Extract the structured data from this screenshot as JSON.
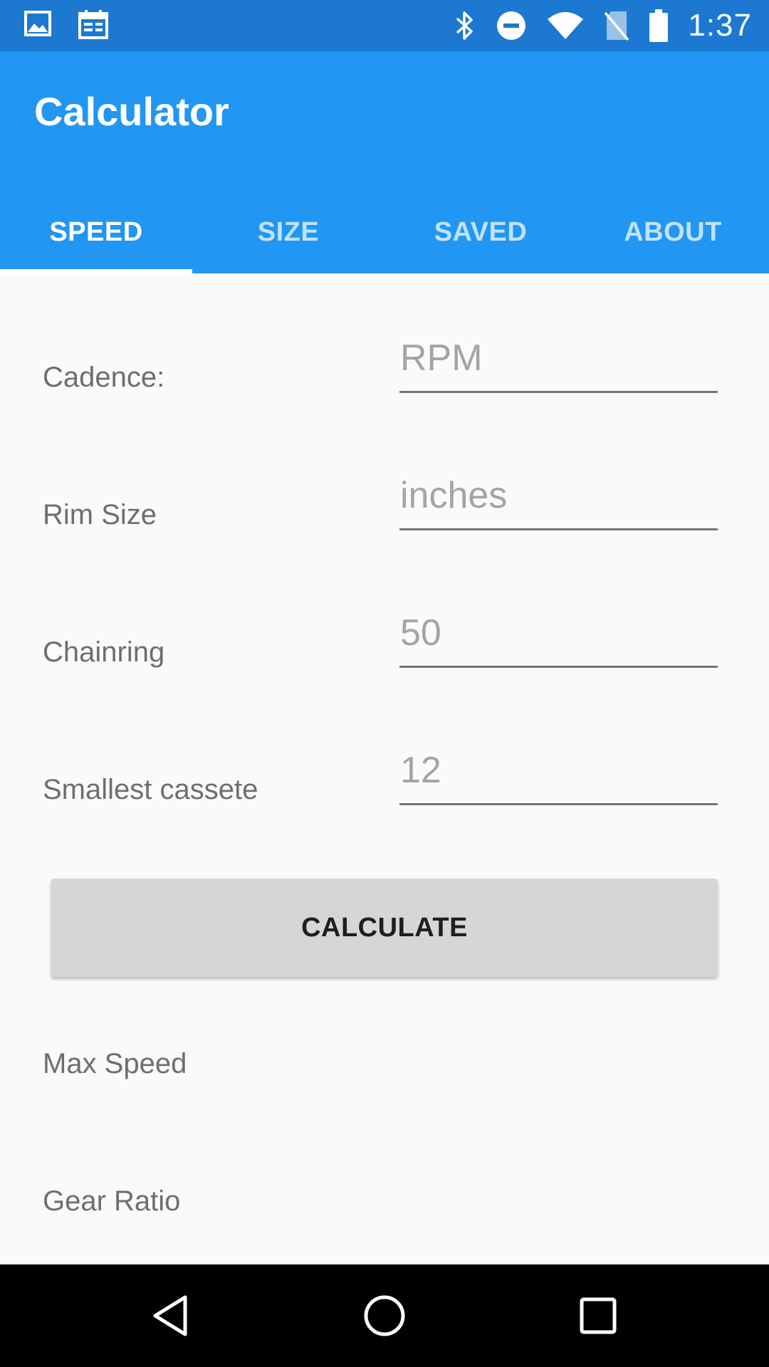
{
  "status_bar": {
    "time": "1:37",
    "left_icons": [
      "image-icon",
      "calendar-icon"
    ],
    "right_icons": [
      "bluetooth-icon",
      "do-not-disturb-icon",
      "wifi-icon",
      "no-sim-icon",
      "battery-icon"
    ]
  },
  "app_bar": {
    "title": "Calculator",
    "tabs": [
      {
        "label": "SPEED",
        "active": true
      },
      {
        "label": "SIZE",
        "active": false
      },
      {
        "label": "SAVED",
        "active": false
      },
      {
        "label": "ABOUT",
        "active": false
      }
    ]
  },
  "form": {
    "cadence": {
      "label": "Cadence:",
      "placeholder": "RPM",
      "value": ""
    },
    "rim_size": {
      "label": "Rim Size",
      "placeholder": "inches",
      "value": ""
    },
    "chainring": {
      "label": "Chainring",
      "placeholder": "50",
      "value": ""
    },
    "smallest_cassette": {
      "label": "Smallest cassete",
      "placeholder": "12",
      "value": ""
    },
    "calculate_label": "CALCULATE"
  },
  "results": {
    "max_speed_label": "Max Speed",
    "gear_ratio_label": "Gear Ratio"
  },
  "nav_bar": {
    "buttons": [
      "back-icon",
      "home-icon",
      "recents-icon"
    ]
  },
  "colors": {
    "status_bar": "#1c78d1",
    "app_bar": "#2196f3",
    "background": "#fafafa",
    "button": "#d6d6d6",
    "nav_bar": "#000000"
  }
}
